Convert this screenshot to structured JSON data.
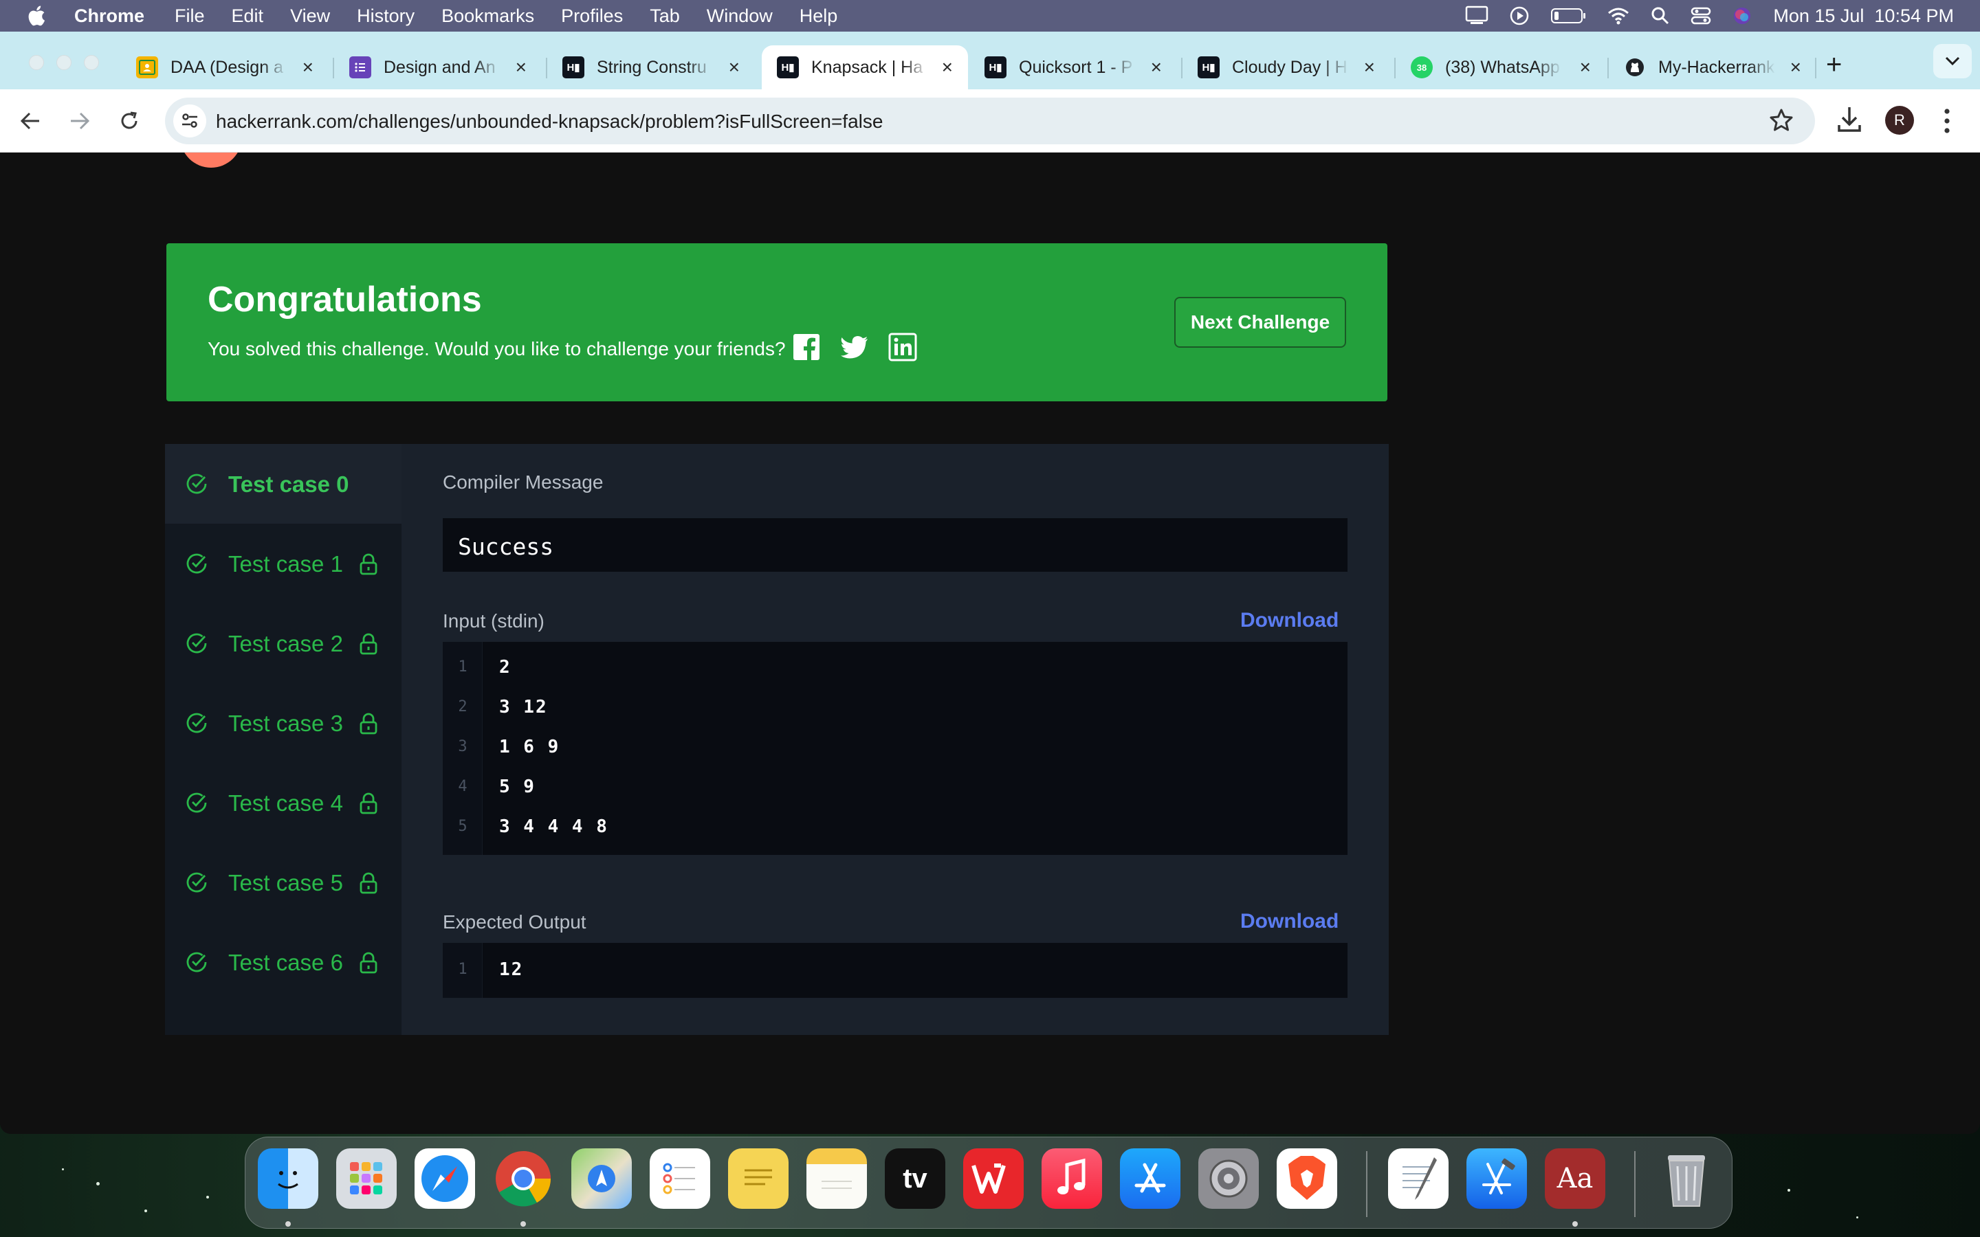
{
  "menubar": {
    "app_name": "Chrome",
    "items": [
      "File",
      "Edit",
      "View",
      "History",
      "Bookmarks",
      "Profiles",
      "Tab",
      "Window",
      "Help"
    ],
    "datetime": "Mon 15 Jul  10:54 PM"
  },
  "browser": {
    "tabs": [
      {
        "title": "DAA (Design a",
        "icon": "google-classroom-icon"
      },
      {
        "title": "Design and An",
        "icon": "forms-icon"
      },
      {
        "title": "String Constru",
        "icon": "hackerrank-icon"
      },
      {
        "title": "Knapsack | Ha",
        "icon": "hackerrank-icon"
      },
      {
        "title": "Quicksort 1 - P",
        "icon": "hackerrank-icon"
      },
      {
        "title": "Cloudy Day | H",
        "icon": "hackerrank-icon"
      },
      {
        "title": "(38) WhatsApp",
        "icon": "whatsapp-icon",
        "badge": "38"
      },
      {
        "title": "My-Hackerrank",
        "icon": "github-icon"
      }
    ],
    "active_tab": 3,
    "url": "hackerrank.com/challenges/unbounded-knapsack/problem?isFullScreen=false",
    "profile_initial": "R",
    "accent": "#c8eaf2"
  },
  "congrats": {
    "title": "Congratulations",
    "message": "You solved this challenge. Would you like to challenge your friends?",
    "next_button": "Next Challenge",
    "color": "#23a03c"
  },
  "test_cases": [
    {
      "label": "Test case 0",
      "locked": false,
      "passed": true
    },
    {
      "label": "Test case 1",
      "locked": true,
      "passed": true
    },
    {
      "label": "Test case 2",
      "locked": true,
      "passed": true
    },
    {
      "label": "Test case 3",
      "locked": true,
      "passed": true
    },
    {
      "label": "Test case 4",
      "locked": true,
      "passed": true
    },
    {
      "label": "Test case 5",
      "locked": true,
      "passed": true
    },
    {
      "label": "Test case 6",
      "locked": true,
      "passed": true
    }
  ],
  "result": {
    "compiler_label": "Compiler Message",
    "compiler_message": "Success",
    "input_label": "Input (stdin)",
    "input_download": "Download",
    "input_lines": [
      {
        "n": "1",
        "text": "2"
      },
      {
        "n": "2",
        "text": "3 12"
      },
      {
        "n": "3",
        "text": "1 6 9"
      },
      {
        "n": "4",
        "text": "5 9"
      },
      {
        "n": "5",
        "text": "3 4 4 4 8"
      }
    ],
    "output_label": "Expected Output",
    "output_download": "Download",
    "output_lines": [
      {
        "n": "1",
        "text": "12"
      }
    ]
  },
  "dock": {
    "apps": [
      "Finder",
      "Launchpad",
      "Safari",
      "Chrome",
      "Maps",
      "Reminders",
      "Stickies",
      "Notes",
      "TV",
      "WPS Office",
      "Music",
      "App Store",
      "System Settings",
      "Brave",
      "TextEdit",
      "Xcode",
      "Dictionary",
      "Trash"
    ],
    "tv_label": "tv",
    "dictionary_label": "Aa"
  }
}
